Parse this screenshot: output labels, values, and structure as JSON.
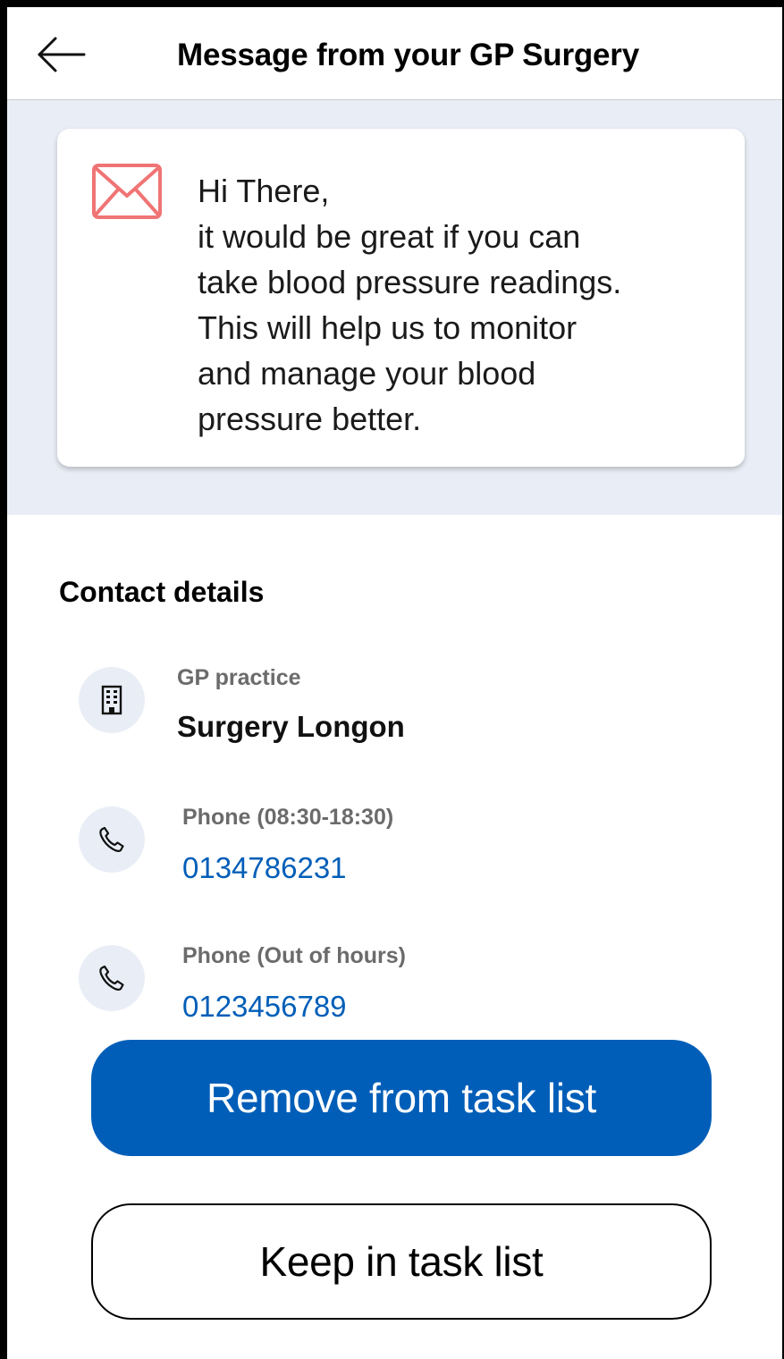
{
  "header": {
    "back_icon": "arrow-left-icon",
    "title": "Message from your GP Surgery"
  },
  "message": {
    "icon": "envelope-icon",
    "icon_color": "#f07474",
    "text": "Hi There,\nit would be great if you can\ntake blood pressure readings.\nThis will help us to monitor\nand manage your blood\npressure better."
  },
  "contact": {
    "title": "Contact details",
    "practice": {
      "icon": "building-icon",
      "label": "GP practice",
      "value": "Surgery Longon"
    },
    "phone_day": {
      "icon": "phone-icon",
      "label": "Phone (08:30-18:30)",
      "value": "0134786231"
    },
    "phone_ooh": {
      "icon": "phone-icon",
      "label": "Phone (Out of hours)",
      "value": "0123456789"
    }
  },
  "actions": {
    "remove_label": "Remove from task list",
    "keep_label": "Keep in task list"
  },
  "colors": {
    "primary": "#005eb8",
    "panel_bg": "#e9eef6",
    "label_gray": "#6b6b6b"
  }
}
